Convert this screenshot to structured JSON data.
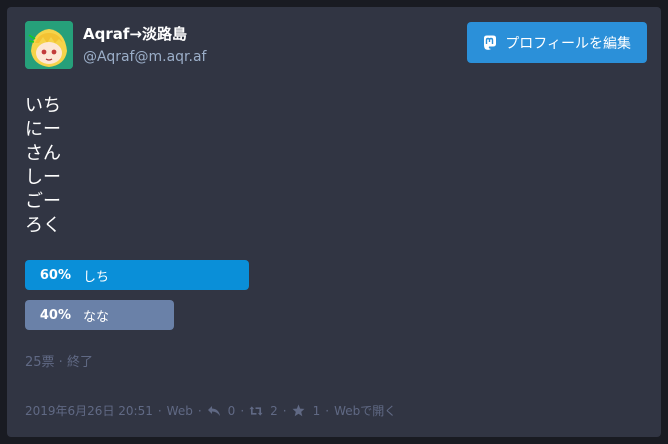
{
  "profile": {
    "display_name": "Aqraf→淡路島",
    "account": "@Aqraf@m.aqr.af",
    "edit_button_label": "プロフィールを編集"
  },
  "status": {
    "lines": [
      "いち",
      "にー",
      "さん",
      "しー",
      "ごー",
      "ろく"
    ]
  },
  "poll": {
    "options": [
      {
        "percent_label": "60%",
        "label": "しち",
        "fraction": 0.6,
        "color": "#0a8fd8"
      },
      {
        "percent_label": "40%",
        "label": "なな",
        "fraction": 0.4,
        "color": "#6a81a8"
      }
    ],
    "footer": "25票 · 終了"
  },
  "meta": {
    "timestamp": "2019年6月26日 20:51",
    "visibility": "Web",
    "replies": "0",
    "reblogs": "2",
    "favourites": "1",
    "open_link": "Webで開く"
  },
  "colors": {
    "accent": "#2b90d9",
    "card_bg": "#313543",
    "muted": "#606984"
  },
  "icons": {
    "avatar": "anime-avatar-image",
    "edit": "mastodon-logo-icon",
    "reply": "reply-icon",
    "reblog": "retweet-icon",
    "favourite": "star-icon"
  }
}
